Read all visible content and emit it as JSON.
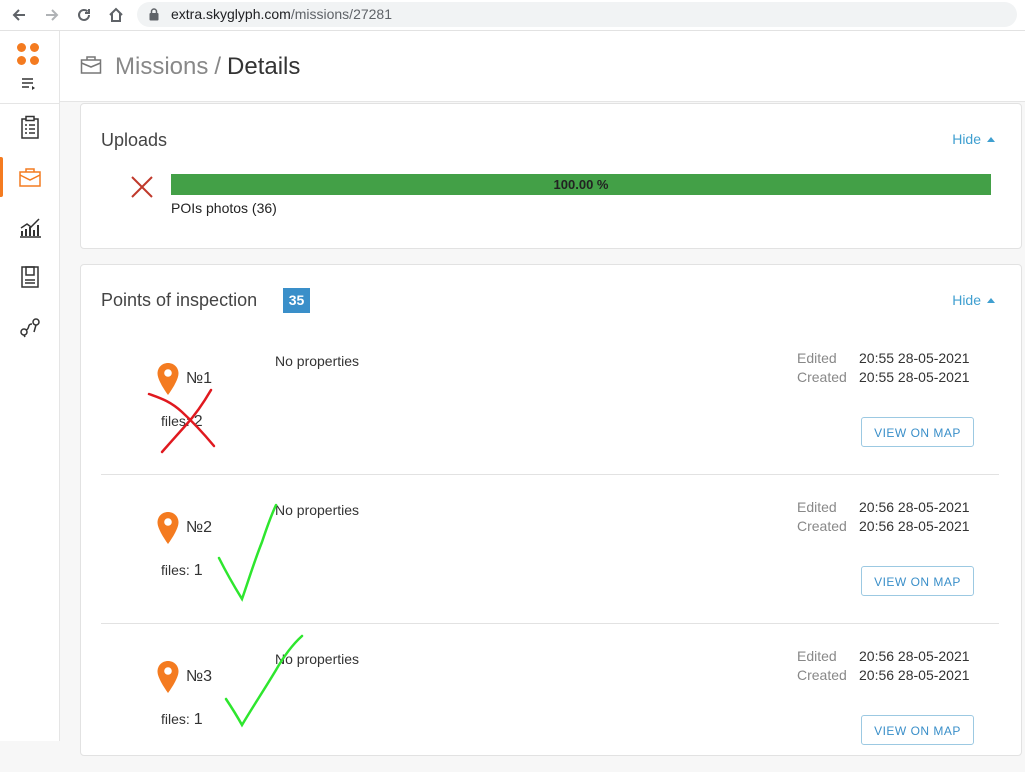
{
  "browser": {
    "url_domain": "extra.skyglyph.com",
    "url_path": "/missions/27281"
  },
  "sidebar": {
    "items": [
      {
        "icon": "clipboard-icon"
      },
      {
        "icon": "briefcase-icon",
        "active": true
      },
      {
        "icon": "chart-icon"
      },
      {
        "icon": "document-icon"
      },
      {
        "icon": "route-icon"
      }
    ]
  },
  "header": {
    "section": "Missions",
    "separator": "/",
    "current": "Details"
  },
  "uploads": {
    "title": "Uploads",
    "hide_label": "Hide",
    "progress_fraction": 1.0,
    "progress_text": "100.00 %",
    "item_label": "POIs photos (36)",
    "progress_color": "#43a047"
  },
  "poi_section": {
    "title": "Points of inspection",
    "count": "35",
    "hide_label": "Hide",
    "edited_label": "Edited",
    "created_label": "Created",
    "files_label": "files:",
    "button_label": "VIEW ON MAP",
    "items": [
      {
        "number": "№1",
        "files": "2",
        "properties": "No properties",
        "edited": "20:55 28-05-2021",
        "created": "20:55 28-05-2021"
      },
      {
        "number": "№2",
        "files": "1",
        "properties": "No properties",
        "edited": "20:56 28-05-2021",
        "created": "20:56 28-05-2021"
      },
      {
        "number": "№3",
        "files": "1",
        "properties": "No properties",
        "edited": "20:56 28-05-2021",
        "created": "20:56 28-05-2021"
      }
    ]
  },
  "colors": {
    "accent": "#f47b20",
    "link": "#3f9fd0",
    "badge": "#3a8fc9",
    "annotation_cross": "#e0191f",
    "annotation_check": "#2ee62e"
  }
}
